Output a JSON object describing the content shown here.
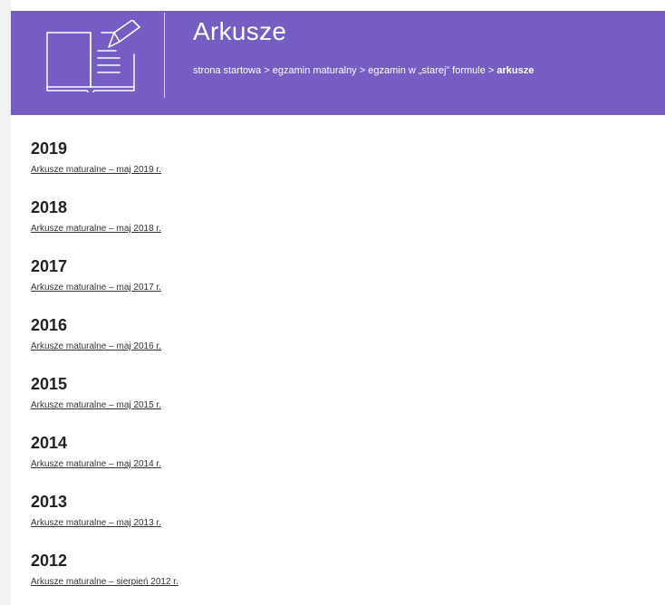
{
  "header": {
    "title": "Arkusze",
    "icon": "open-book-pencil-icon",
    "background_color": "#755dc4",
    "breadcrumb": [
      {
        "label": "strona startowa",
        "current": false
      },
      {
        "label": "egzamin maturalny",
        "current": false
      },
      {
        "label": "egzamin w „starej” formule",
        "current": false
      },
      {
        "label": "arkusze",
        "current": true
      }
    ],
    "breadcrumb_separator": ">"
  },
  "years": [
    {
      "year": "2019",
      "link": "Arkusze maturalne – maj 2019 r."
    },
    {
      "year": "2018",
      "link": "Arkusze maturalne – maj 2018 r."
    },
    {
      "year": "2017",
      "link": "Arkusze maturalne – maj 2017 r."
    },
    {
      "year": "2016",
      "link": "Arkusze maturalne – maj 2016 r."
    },
    {
      "year": "2015",
      "link": "Arkusze maturalne – maj 2015 r."
    },
    {
      "year": "2014",
      "link": "Arkusze maturalne – maj 2014 r."
    },
    {
      "year": "2013",
      "link": "Arkusze maturalne – maj 2013 r."
    },
    {
      "year": "2012",
      "link": "Arkusze maturalne – sierpień 2012 r."
    }
  ]
}
